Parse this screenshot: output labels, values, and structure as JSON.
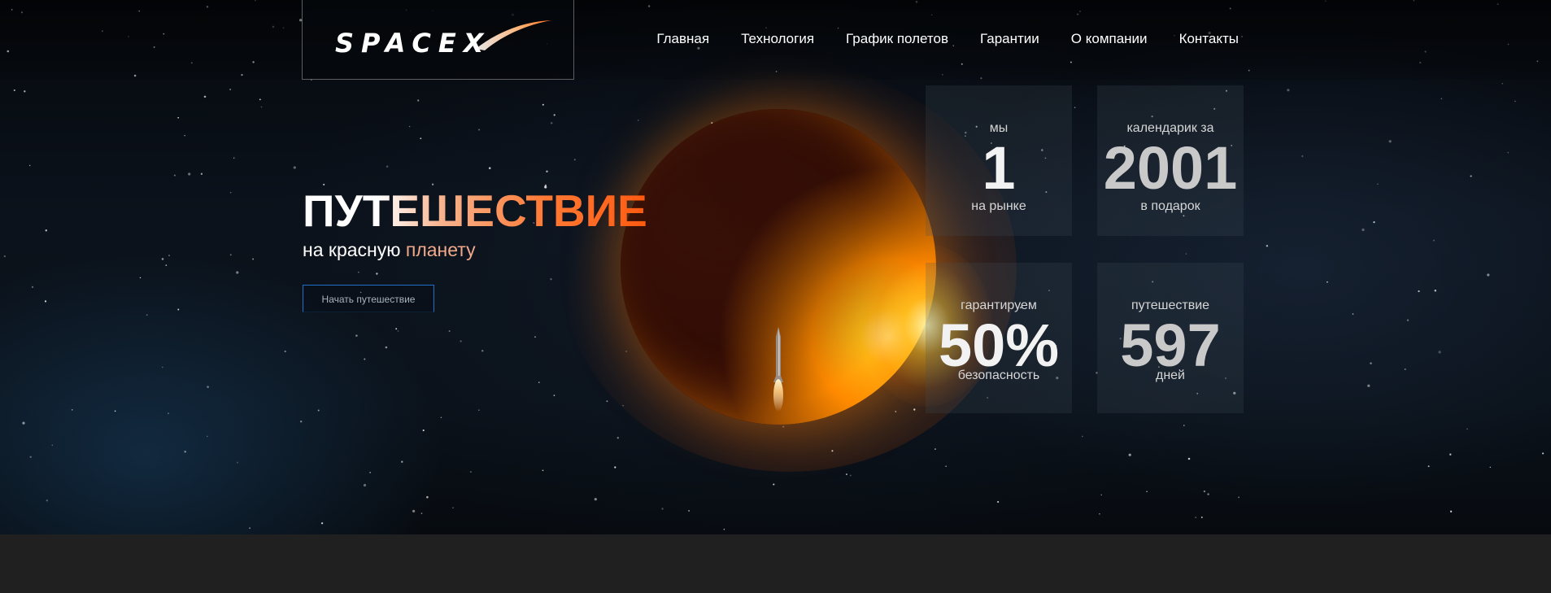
{
  "header": {
    "logo_text": "SPACEX",
    "nav": [
      {
        "label": "Главная"
      },
      {
        "label": "Технология"
      },
      {
        "label": "График полетов"
      },
      {
        "label": "Гарантии"
      },
      {
        "label": "О компании"
      },
      {
        "label": "Контакты"
      }
    ]
  },
  "hero": {
    "title": "ПУТЕШЕСТВИЕ",
    "subtitle_part1": "на красную",
    "subtitle_part2": "планету",
    "button_label": "Начать путешествие"
  },
  "stats": [
    {
      "top": "мы",
      "value": "1",
      "bottom": "на рынке"
    },
    {
      "top": "календарик за",
      "value": "2001",
      "bottom": "в подарок"
    },
    {
      "top": "гарантируем",
      "value": "50%",
      "bottom": "безопасность"
    },
    {
      "top": "путешествие",
      "value": "597",
      "bottom": "дней"
    }
  ],
  "colors": {
    "accent_orange": "#ff6a1a",
    "button_border": "#1f6fc9",
    "footer_bar": "#202020"
  }
}
